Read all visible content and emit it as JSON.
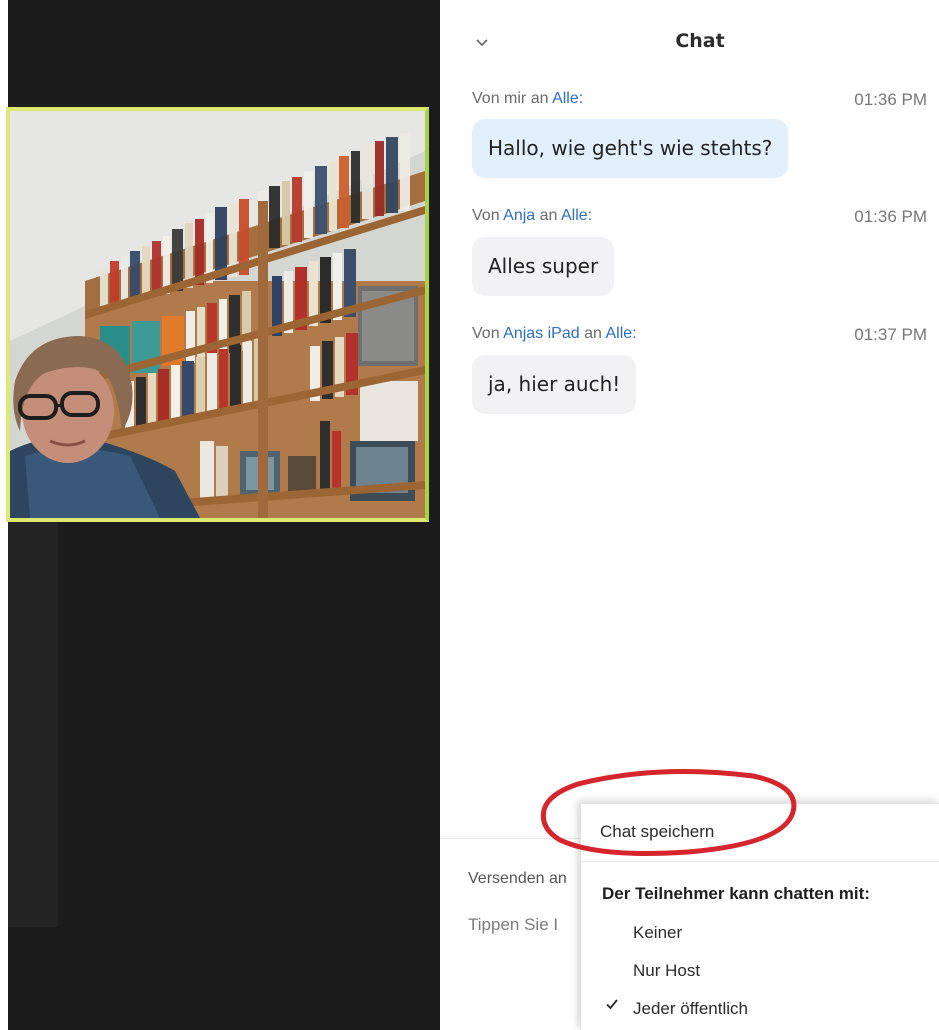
{
  "chat": {
    "title": "Chat",
    "collapse_icon": "chevron-down-icon",
    "messages": [
      {
        "prefix": "Von ",
        "sender": "mir",
        "sender_linked": false,
        "connector": " an ",
        "recipient": "Alle:",
        "time": "01:36 PM",
        "text": "Hallo, wie geht's wie stehts?",
        "mine": true
      },
      {
        "prefix": "Von ",
        "sender": "Anja",
        "sender_linked": true,
        "connector": " an ",
        "recipient": "Alle:",
        "time": "01:36 PM",
        "text": "Alles super",
        "mine": false
      },
      {
        "prefix": "Von ",
        "sender": "Anjas iPad",
        "sender_linked": true,
        "connector": " an ",
        "recipient": "Alle:",
        "time": "01:37 PM",
        "text": "ja, hier auch!",
        "mine": false
      }
    ],
    "send_to_label": "Versenden an",
    "input_placeholder": "Tippen Sie I"
  },
  "menu": {
    "save_label": "Chat speichern",
    "heading": "Der Teilnehmer kann chatten mit:",
    "options": [
      "Keiner",
      "Nur Host",
      "Jeder öffentlich"
    ],
    "selected": "Jeder öffentlich",
    "check_icon": "checkmark-icon"
  },
  "colors": {
    "accent_link": "#2d6fc6",
    "my_bubble": "#e1f0fc",
    "other_bubble": "#f2f2f5",
    "video_border": "#dcea72",
    "annotation": "#d6262d"
  }
}
